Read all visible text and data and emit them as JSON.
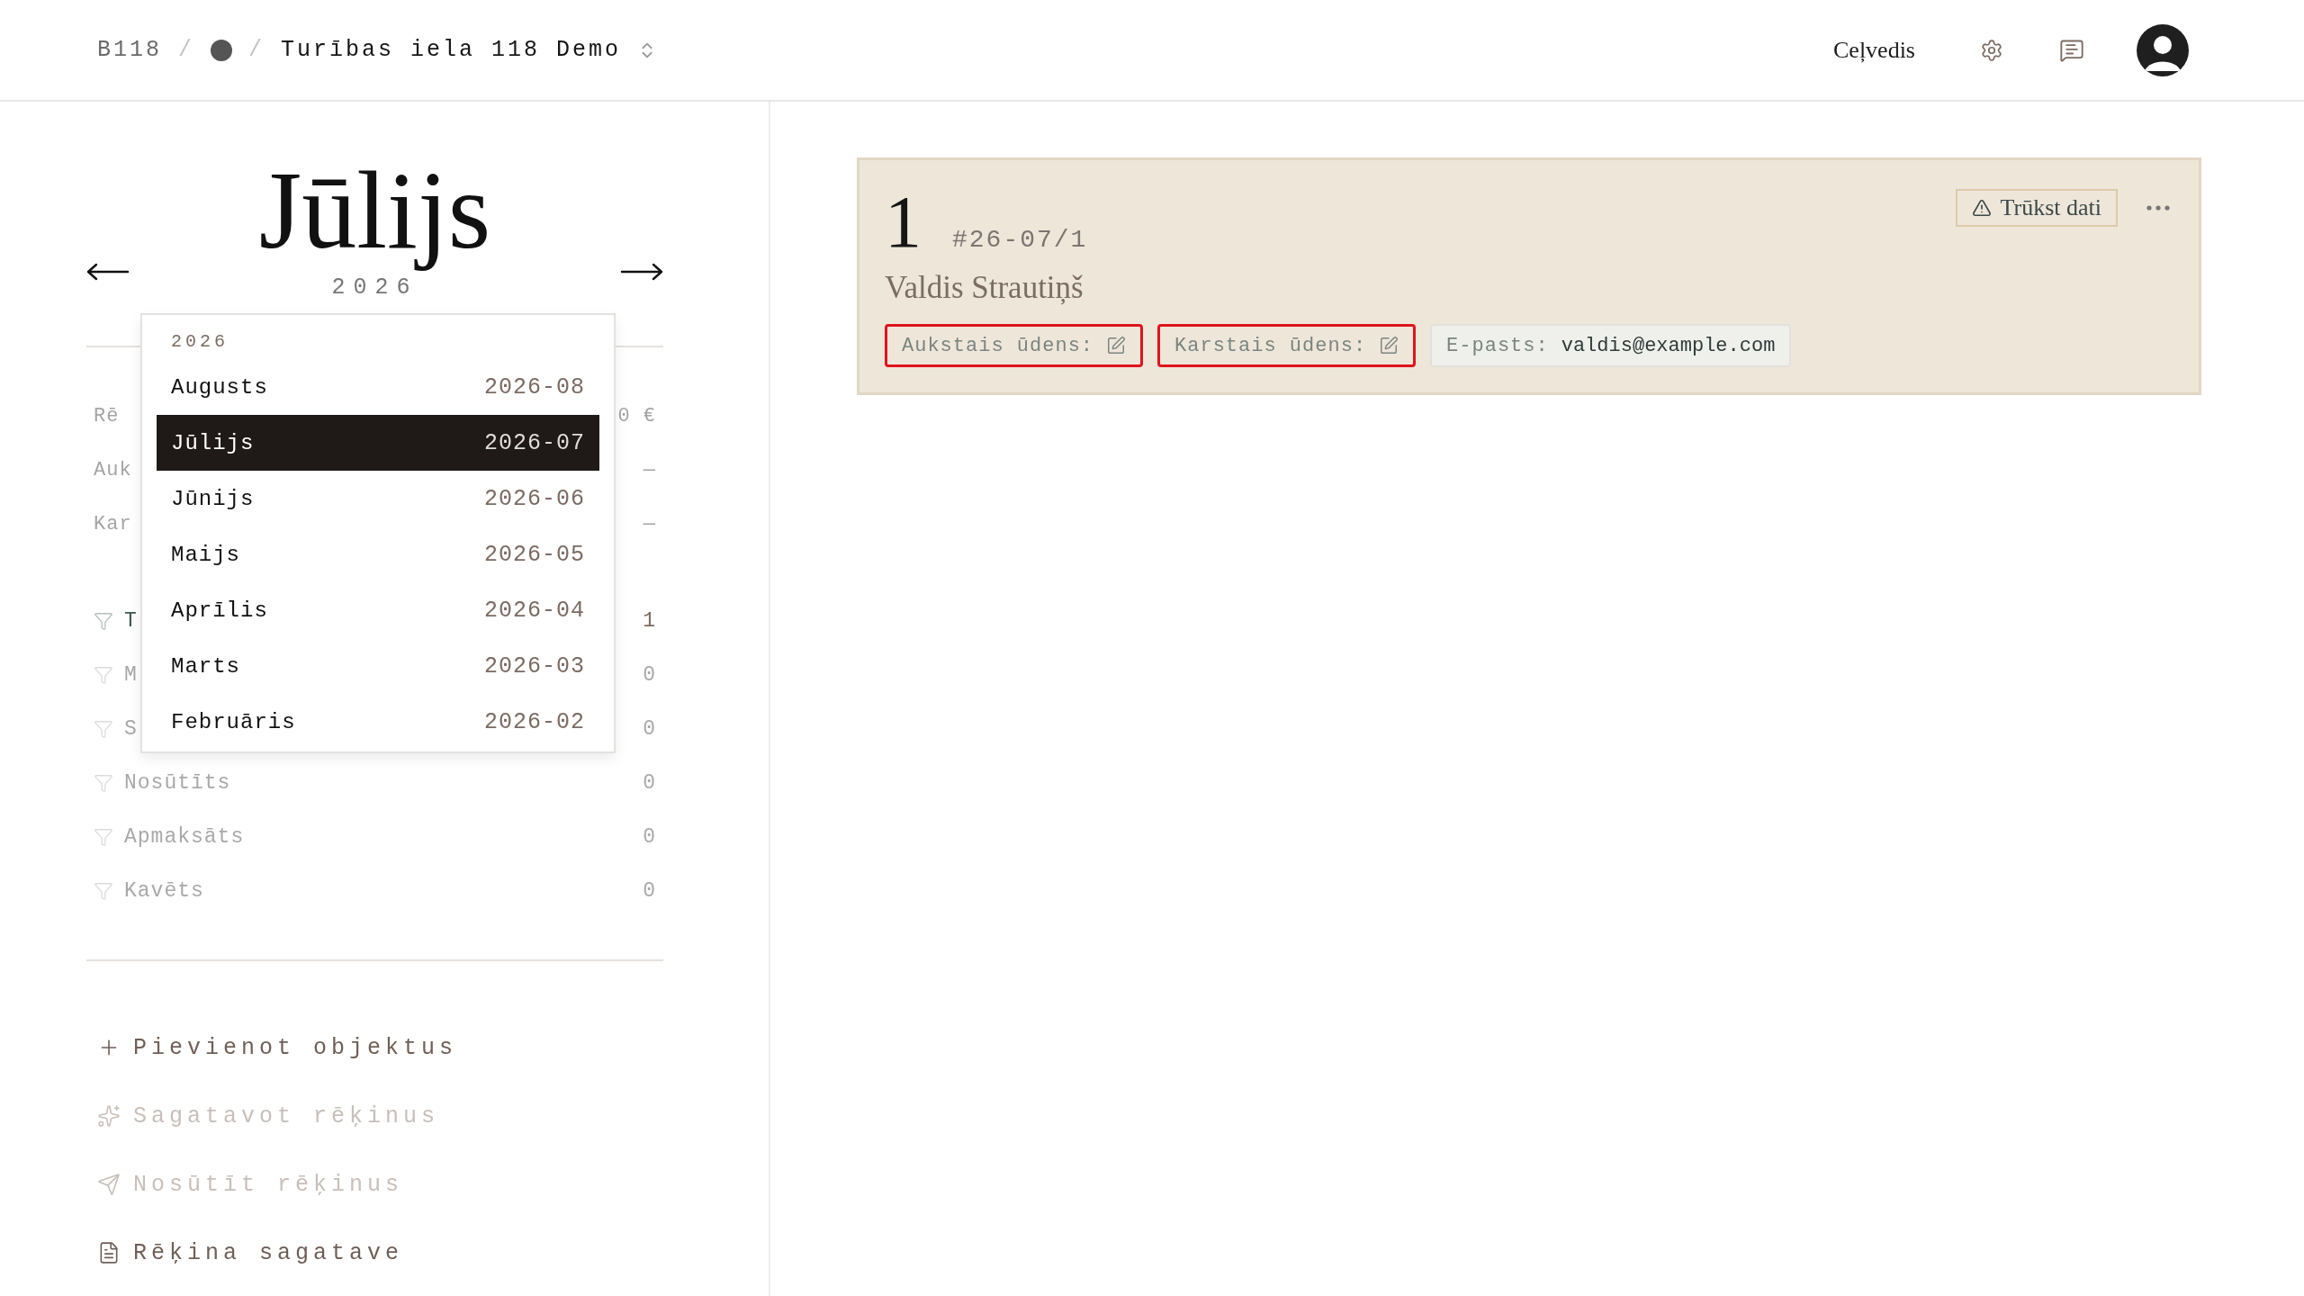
{
  "header": {
    "breadcrumb": {
      "code": "B118",
      "separator": "/",
      "title": "Turības iela 118 Demo"
    },
    "guide_link": "Ceļvedis"
  },
  "sidebar": {
    "month": "Jūlijs",
    "year": "2026",
    "summary": [
      {
        "label": "Rē",
        "value": "0 €"
      },
      {
        "label": "Auk",
        "value": "—"
      },
      {
        "label": "Kar",
        "value": "—"
      }
    ],
    "filters": [
      {
        "label": "T",
        "count": "1",
        "disabled": false
      },
      {
        "label": "M",
        "count": "0",
        "disabled": true
      },
      {
        "label": "S",
        "count": "0",
        "disabled": true
      },
      {
        "label": "Nosūtīts",
        "count": "0",
        "disabled": true
      },
      {
        "label": "Apmaksāts",
        "count": "0",
        "disabled": true
      },
      {
        "label": "Kavēts",
        "count": "0",
        "disabled": true
      }
    ],
    "actions": [
      {
        "kind": "add",
        "label": "Pievienot objektus",
        "disabled": false
      },
      {
        "kind": "generate",
        "label": "Sagatavot rēķinus",
        "disabled": true
      },
      {
        "kind": "send",
        "label": "Nosūtīt rēķinus",
        "disabled": true
      },
      {
        "kind": "template",
        "label": "Rēķina sagatave",
        "disabled": false
      }
    ]
  },
  "month_menu": {
    "year": "2026",
    "items": [
      {
        "label": "Augusts",
        "code": "2026-08",
        "selected": false
      },
      {
        "label": "Jūlijs",
        "code": "2026-07",
        "selected": true
      },
      {
        "label": "Jūnijs",
        "code": "2026-06",
        "selected": false
      },
      {
        "label": "Maijs",
        "code": "2026-05",
        "selected": false
      },
      {
        "label": "Aprīlis",
        "code": "2026-04",
        "selected": false
      },
      {
        "label": "Marts",
        "code": "2026-03",
        "selected": false
      },
      {
        "label": "Februāris",
        "code": "2026-02",
        "selected": false
      }
    ]
  },
  "invoice_card": {
    "number": "1",
    "reference": "#26-07/1",
    "name": "Valdis Strautiņš",
    "badge": "Trūkst dati",
    "fields": [
      {
        "kind": "editable",
        "label": "Aukstais ūdens:",
        "missing": true
      },
      {
        "kind": "editable",
        "label": "Karstais ūdens:",
        "missing": true
      },
      {
        "kind": "info",
        "label": "E-pasts:",
        "value": "valdis@example.com",
        "missing": false
      }
    ]
  }
}
